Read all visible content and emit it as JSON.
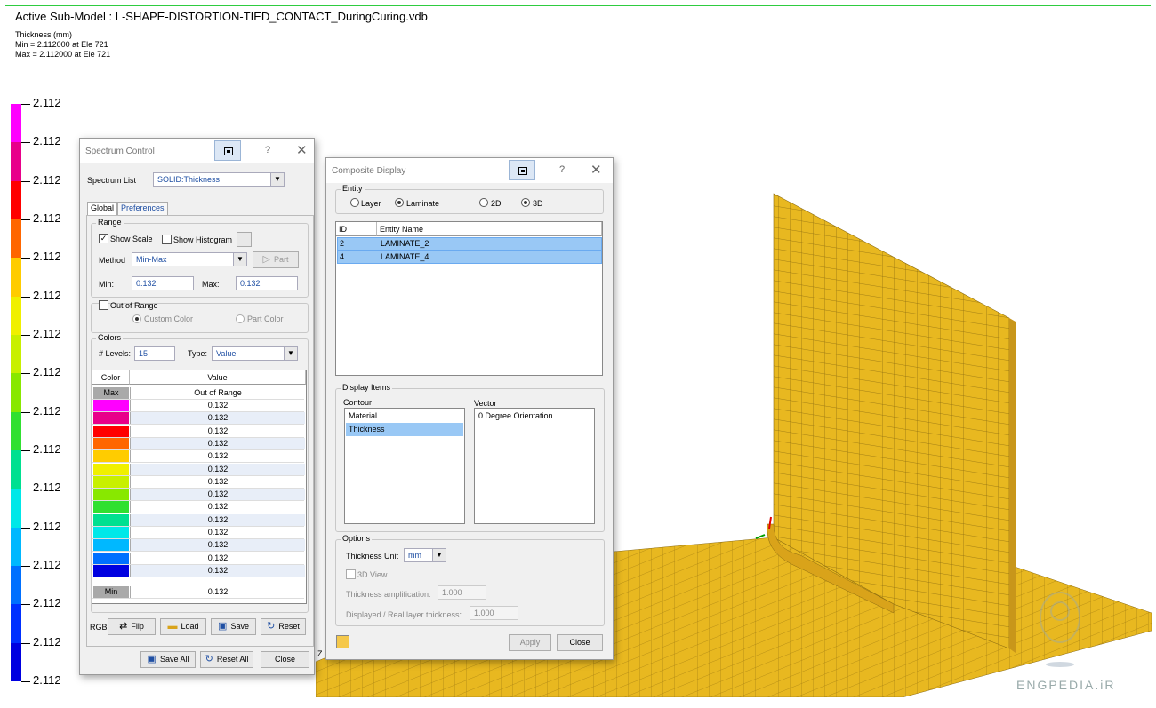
{
  "header": {
    "title": "Active Sub-Model : L-SHAPE-DISTORTION-TIED_CONTACT_DuringCuring.vdb",
    "result_name": "Thickness (mm)",
    "min_text": "Min = 2.112000 at Ele 721",
    "max_text": "Max = 2.112000 at Ele 721"
  },
  "legend": {
    "labels": [
      "2.112",
      "2.112",
      "2.112",
      "2.112",
      "2.112",
      "2.112",
      "2.112",
      "2.112",
      "2.112",
      "2.112",
      "2.112",
      "2.112",
      "2.112",
      "2.112",
      "2.112",
      "2.112"
    ],
    "colors": [
      "#ff00ff",
      "#e8008a",
      "#ff0000",
      "#ff6600",
      "#ffcc00",
      "#f0f000",
      "#c8f000",
      "#88e800",
      "#30e030",
      "#00e090",
      "#00e8e8",
      "#00b8ff",
      "#0070ff",
      "#0030ff",
      "#0000e0"
    ]
  },
  "spectrum": {
    "title": "Spectrum Control",
    "help": "?",
    "close_x": "✕",
    "list_label": "Spectrum List",
    "list_value": "SOLID:Thickness",
    "tabs": [
      "Global",
      "Preferences"
    ],
    "range_label": "Range",
    "show_scale": "Show Scale",
    "show_hist": "Show Histogram",
    "method_label": "Method",
    "method_value": "Min-Max",
    "part_btn": "Part",
    "min_label": "Min:",
    "min_value": "0.132",
    "max_label": "Max:",
    "max_value": "0.132",
    "out_of_range": "Out of Range",
    "custom_color": "Custom Color",
    "part_color": "Part Color",
    "colors_label": "Colors",
    "levels_label": "# Levels:",
    "levels_value": "15",
    "type_label": "Type:",
    "type_value": "Value",
    "col_color": "Color",
    "col_value": "Value",
    "max_row": {
      "tag": "Max",
      "value": "Out of Range"
    },
    "min_row": {
      "tag": "Min",
      "value": "0.132"
    },
    "rows": [
      {
        "color": "#ff00ff",
        "value": "0.132"
      },
      {
        "color": "#e8008a",
        "value": "0.132"
      },
      {
        "color": "#ff0000",
        "value": "0.132"
      },
      {
        "color": "#ff6600",
        "value": "0.132"
      },
      {
        "color": "#ffcc00",
        "value": "0.132"
      },
      {
        "color": "#f0f000",
        "value": "0.132"
      },
      {
        "color": "#c8f000",
        "value": "0.132"
      },
      {
        "color": "#88e800",
        "value": "0.132"
      },
      {
        "color": "#30e030",
        "value": "0.132"
      },
      {
        "color": "#00e090",
        "value": "0.132"
      },
      {
        "color": "#00e8e8",
        "value": "0.132"
      },
      {
        "color": "#00b8ff",
        "value": "0.132"
      },
      {
        "color": "#0070ff",
        "value": "0.132"
      },
      {
        "color": "#0000e0",
        "value": "0.132"
      }
    ],
    "rgb_label": "RGB:",
    "flip": "Flip",
    "load": "Load",
    "save": "Save",
    "reset": "Reset",
    "save_all": "Save All",
    "reset_all": "Reset All",
    "close": "Close"
  },
  "composite": {
    "title": "Composite Display",
    "help": "?",
    "close_x": "✕",
    "entity_label": "Entity",
    "layer": "Layer",
    "laminate": "Laminate",
    "d2": "2D",
    "d3": "3D",
    "col_id": "ID",
    "col_name": "Entity Name",
    "entities": [
      {
        "id": "2",
        "name": "LAMINATE_2"
      },
      {
        "id": "4",
        "name": "LAMINATE_4"
      }
    ],
    "display_items": "Display Items",
    "contour_label": "Contour",
    "vector_label": "Vector",
    "contour_items": [
      "Material",
      "Thickness"
    ],
    "vector_items": [
      "0 Degree Orientation"
    ],
    "options_label": "Options",
    "thickness_unit_label": "Thickness Unit",
    "thickness_unit": "mm",
    "view3d": "3D View",
    "amp_label": "Thickness amplification:",
    "amp_value": "1.000",
    "ratio_label": "Displayed / Real layer thickness:",
    "ratio_value": "1.000",
    "apply": "Apply",
    "close": "Close"
  },
  "viewport": {
    "axis_label": "Z",
    "watermark": "ENGPEDIA.iR",
    "part_color": "#e8b820",
    "mesh_color": "#8a6a10"
  }
}
